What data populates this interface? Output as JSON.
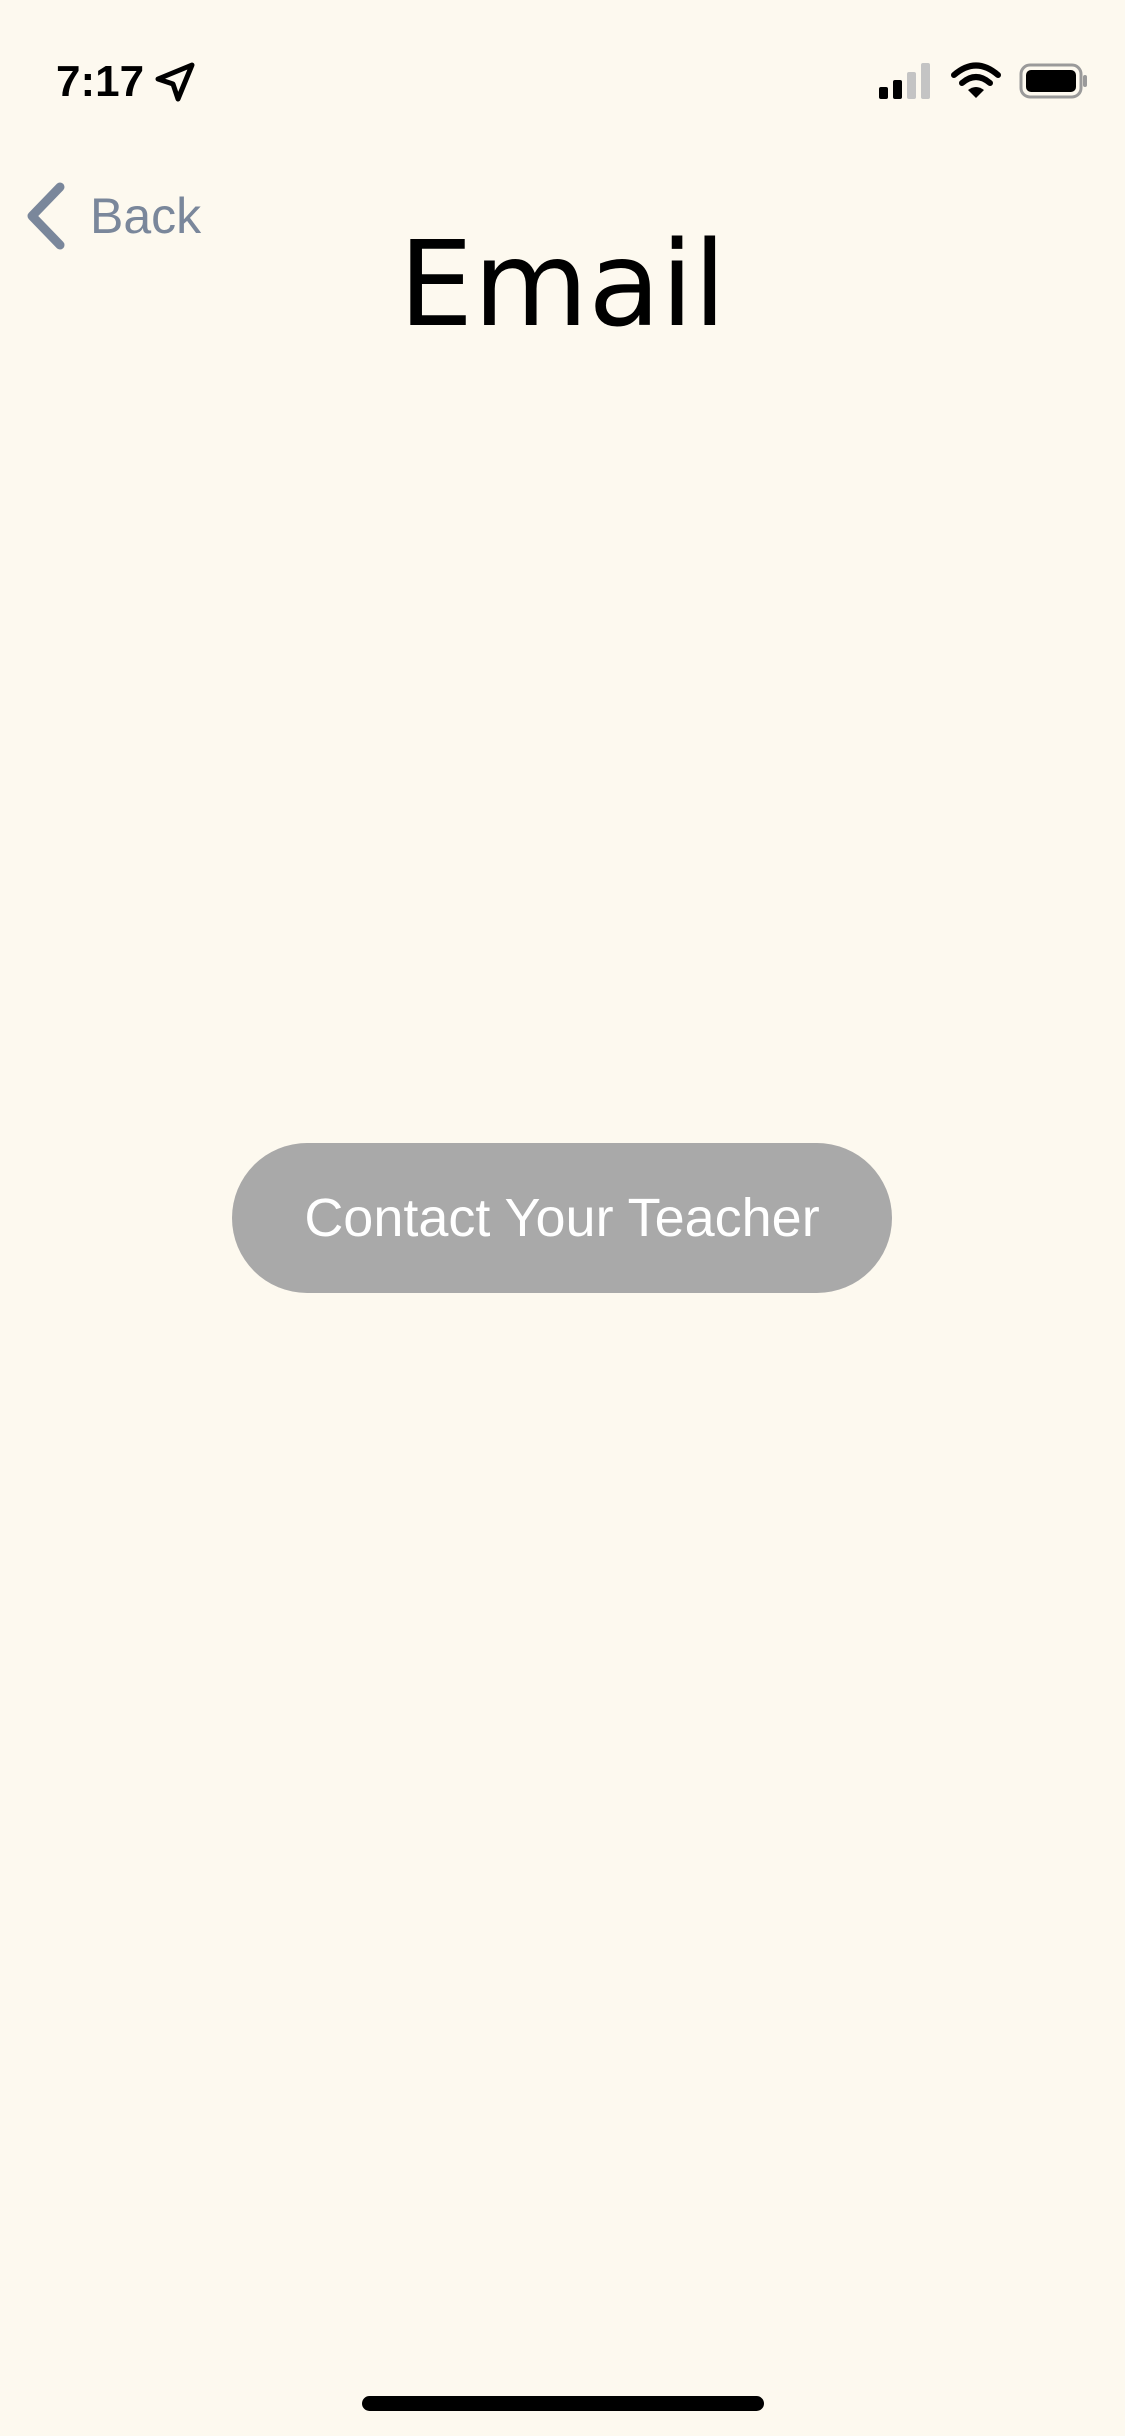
{
  "status_bar": {
    "time": "7:17",
    "icons": [
      "location-arrow-icon",
      "cellular-signal-icon",
      "wifi-icon",
      "battery-icon"
    ]
  },
  "nav": {
    "back_label": "Back",
    "back_icon": "chevron-left-icon"
  },
  "page": {
    "title": "Email"
  },
  "main": {
    "contact_button_label": "Contact Your Teacher"
  },
  "colors": {
    "background": "#fdf9ef",
    "back_tint": "#7a879b",
    "button_fill": "#a9a9a9",
    "button_text": "#ffffff",
    "title_text": "#000000"
  }
}
